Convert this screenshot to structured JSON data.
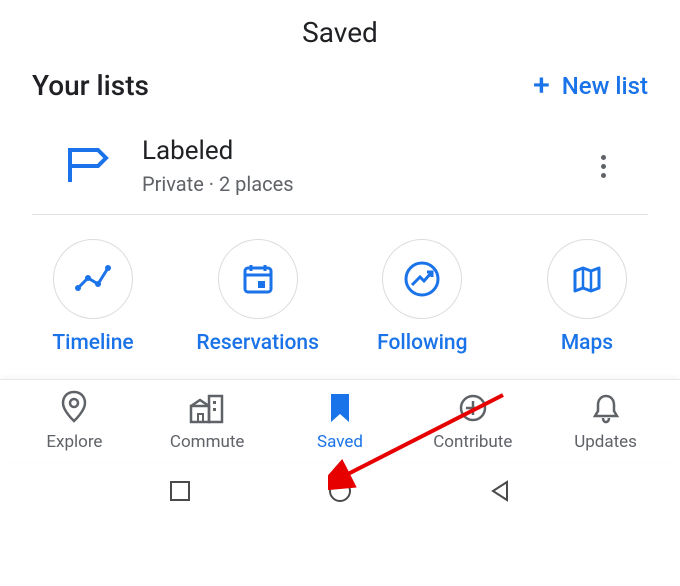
{
  "colors": {
    "primary": "#1a73e8",
    "text": "#202124",
    "muted": "#5f6368"
  },
  "header": {
    "title": "Saved"
  },
  "lists_section": {
    "title": "Your lists",
    "new_list_label": "New list"
  },
  "lists": [
    {
      "name": "Labeled",
      "meta": "Private · 2 places"
    }
  ],
  "shortcuts": [
    {
      "label": "Timeline"
    },
    {
      "label": "Reservations"
    },
    {
      "label": "Following"
    },
    {
      "label": "Maps"
    }
  ],
  "bottom_nav": [
    {
      "label": "Explore",
      "active": false
    },
    {
      "label": "Commute",
      "active": false
    },
    {
      "label": "Saved",
      "active": true
    },
    {
      "label": "Contribute",
      "active": false
    },
    {
      "label": "Updates",
      "active": false
    }
  ]
}
